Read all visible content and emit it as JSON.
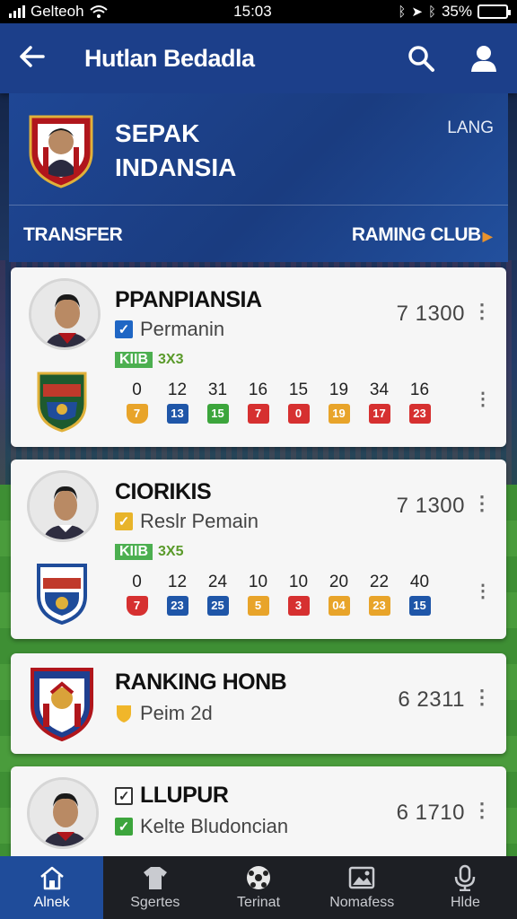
{
  "status_bar": {
    "carrier": "Gelteoh",
    "time": "15:03",
    "battery": "35%"
  },
  "app_bar": {
    "title": "Hutlan Bedadla"
  },
  "hero": {
    "title_line1": "SEPAK",
    "title_line2": "INDANSIA",
    "lang": "LANG",
    "tab_left": "TRANSFER",
    "tab_right": "RAMING CLUB"
  },
  "cards": [
    {
      "name": "PPANPIANSIA",
      "sub": "Permanin",
      "score": "7 1300",
      "tag_badge": "KIIB",
      "tag_text": "3X3",
      "stats": [
        {
          "num": "0",
          "chip": "7",
          "color": "#e8a42a"
        },
        {
          "num": "12",
          "chip": "13",
          "color": "#1f56a8"
        },
        {
          "num": "31",
          "chip": "15",
          "color": "#3ca53c"
        },
        {
          "num": "16",
          "chip": "7",
          "color": "#d63030"
        },
        {
          "num": "15",
          "chip": "0",
          "color": "#d63030"
        },
        {
          "num": "19",
          "chip": "19",
          "color": "#e8a42a"
        },
        {
          "num": "34",
          "chip": "17",
          "color": "#d63030"
        },
        {
          "num": "16",
          "chip": "23",
          "color": "#d63030"
        }
      ]
    },
    {
      "name": "CIORIKIS",
      "sub": "Reslr Pemain",
      "score": "7 1300",
      "tag_badge": "KIIB",
      "tag_text": "3X5",
      "stats": [
        {
          "num": "0",
          "chip": "7",
          "color": "#d63030"
        },
        {
          "num": "12",
          "chip": "23",
          "color": "#1f56a8"
        },
        {
          "num": "24",
          "chip": "25",
          "color": "#1f56a8"
        },
        {
          "num": "10",
          "chip": "5",
          "color": "#e8a42a"
        },
        {
          "num": "10",
          "chip": "3",
          "color": "#d63030"
        },
        {
          "num": "20",
          "chip": "04",
          "color": "#e8a42a"
        },
        {
          "num": "22",
          "chip": "23",
          "color": "#e8a42a"
        },
        {
          "num": "40",
          "chip": "15",
          "color": "#1f56a8"
        }
      ]
    },
    {
      "name": "RANKING HONB",
      "sub": "Peim 2d",
      "score": "6 2311"
    },
    {
      "name": "LLUPUR",
      "sub": "Kelte Bludoncian",
      "score": "6 1710"
    }
  ],
  "bottom_nav": [
    {
      "label": "Alnek",
      "icon": "home-icon"
    },
    {
      "label": "Sgertes",
      "icon": "jersey-icon"
    },
    {
      "label": "Terinat",
      "icon": "ball-icon"
    },
    {
      "label": "Nomafess",
      "icon": "photo-icon"
    },
    {
      "label": "Hlde",
      "icon": "mic-icon"
    }
  ],
  "colors": {
    "primary": "#1c3f8a",
    "nav_active": "#1f4c9a",
    "nav_bg": "#1d1f24"
  }
}
